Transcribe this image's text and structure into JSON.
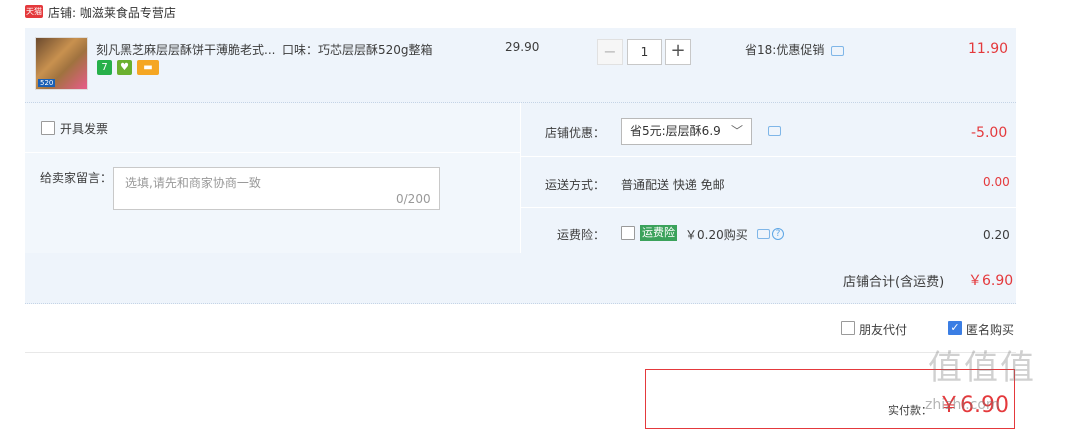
{
  "shop": {
    "badge": "天猫",
    "label": "店铺: 咖滋莱食品专营店"
  },
  "item": {
    "thumb_tag": "520",
    "title": "刻凡黑芝麻层层酥饼干薄脆老式...",
    "spec": "口味：巧芯层层酥520g整箱",
    "badges": [
      "7",
      "♥",
      "▬"
    ],
    "unit_price": "29.90",
    "qty_minus": "−",
    "quantity": "1",
    "qty_plus": "+",
    "promo": "省18:优惠促销",
    "subtotal": "11.90"
  },
  "invoice": {
    "label": "开具发票"
  },
  "memo": {
    "label": "给卖家留言：",
    "placeholder": "选填,请先和商家协商一致",
    "count": "0/200"
  },
  "shop_coupon": {
    "label": "店铺优惠：",
    "selected": "省5元:层层酥6.9",
    "value": "-5.00"
  },
  "shipping": {
    "label": "运送方式：",
    "method": "普通配送 快递 免邮",
    "value": "0.00"
  },
  "freight_insurance": {
    "label": "运费险：",
    "badge": "运费险",
    "text": "￥0.20购买",
    "help": "?",
    "value": "0.20"
  },
  "shop_total": {
    "label": "店铺合计(含运费)",
    "value": "￥6.90"
  },
  "options": {
    "friend_pay": "朋友代付",
    "anonymous": "匿名购买",
    "anonymous_check": "✓"
  },
  "payment": {
    "label": "实付款：",
    "value": "￥6.90"
  },
  "watermark": {
    "text": "值值值",
    "url": "zhizhi.com"
  },
  "colors": {
    "price_red": "#e4393c",
    "link_blue": "#3b7ee4",
    "row_bg": "#eef4fb",
    "freight_green": "#3ba25b"
  }
}
